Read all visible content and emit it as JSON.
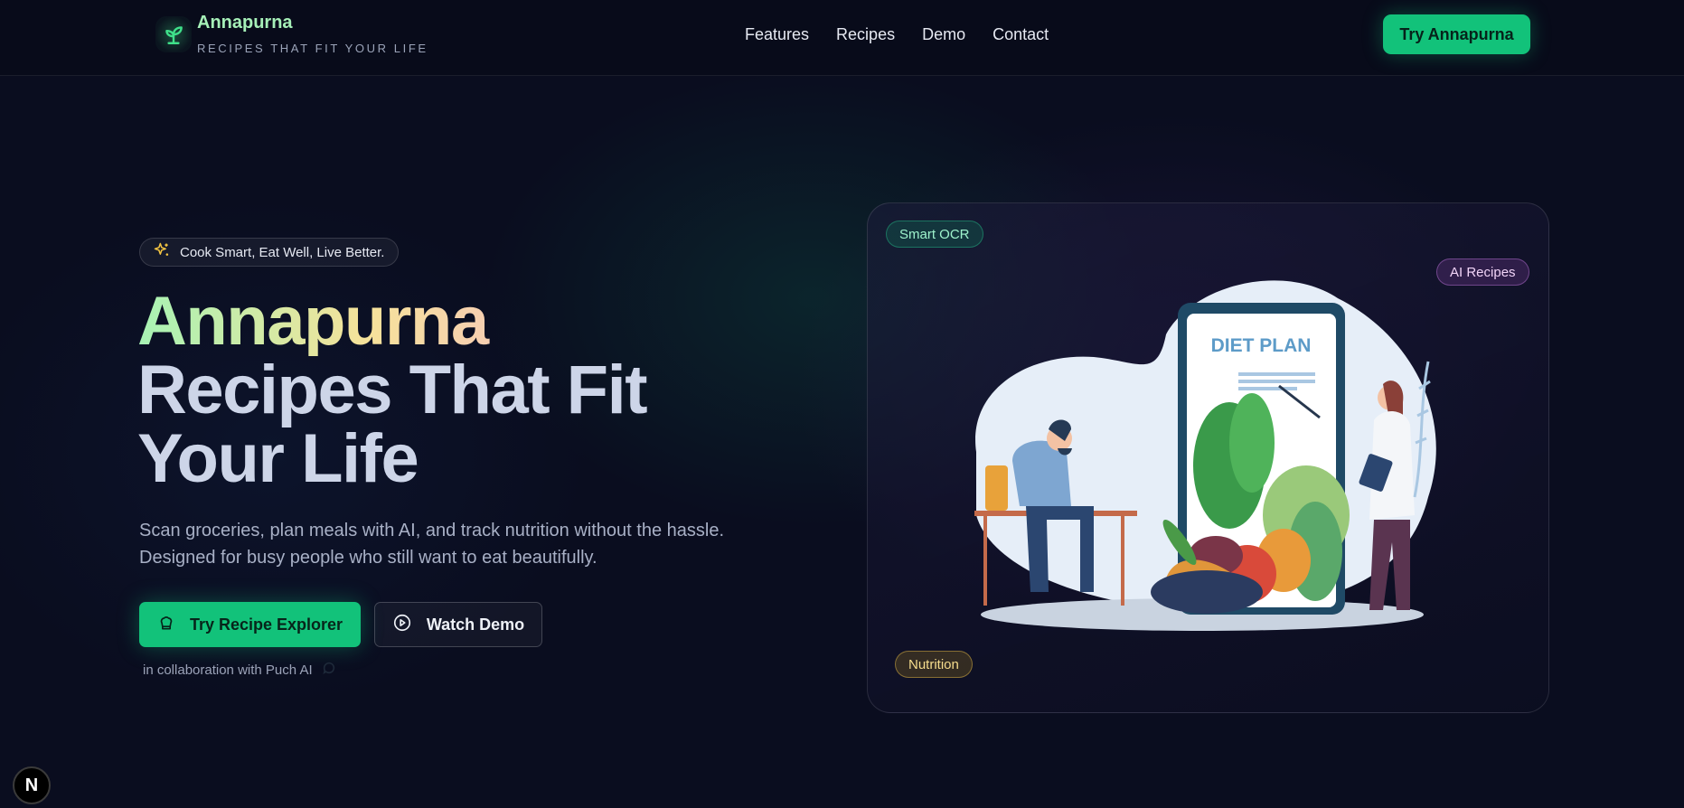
{
  "header": {
    "brand_name": "Annapurna",
    "brand_tagline": "RECIPES THAT FIT YOUR LIFE",
    "nav": [
      "Features",
      "Recipes",
      "Demo",
      "Contact"
    ],
    "cta_label": "Try Annapurna"
  },
  "hero": {
    "pill_text": "Cook Smart, Eat Well, Live Better.",
    "title_brand": "Annapurna",
    "title_line1": "Recipes That Fit",
    "title_line2": "Your Life",
    "subtitle_line1": "Scan groceries, plan meals with AI, and track nutrition without the hassle.",
    "subtitle_line2": "Designed for busy people who still want to eat beautifully.",
    "primary_cta": "Try Recipe Explorer",
    "secondary_cta": "Watch Demo",
    "collab_text": "in collaboration with Puch AI"
  },
  "card": {
    "tags": [
      "Smart OCR",
      "AI Recipes",
      "Nutrition"
    ],
    "illustration_text": "DIET PLAN"
  },
  "dev_badge": "N",
  "colors": {
    "accent": "#12c27a",
    "background": "#0a0d1f",
    "tag_ocr": "#9ef2cc",
    "tag_ai": "#f1d4f7",
    "tag_nutrition": "#f6dc8d"
  },
  "icons": {
    "logo": "sprout-icon",
    "pill": "sparkles-icon",
    "primary_cta": "chef-hat-icon",
    "secondary_cta": "play-circle-icon",
    "collab": "chat-icon"
  }
}
